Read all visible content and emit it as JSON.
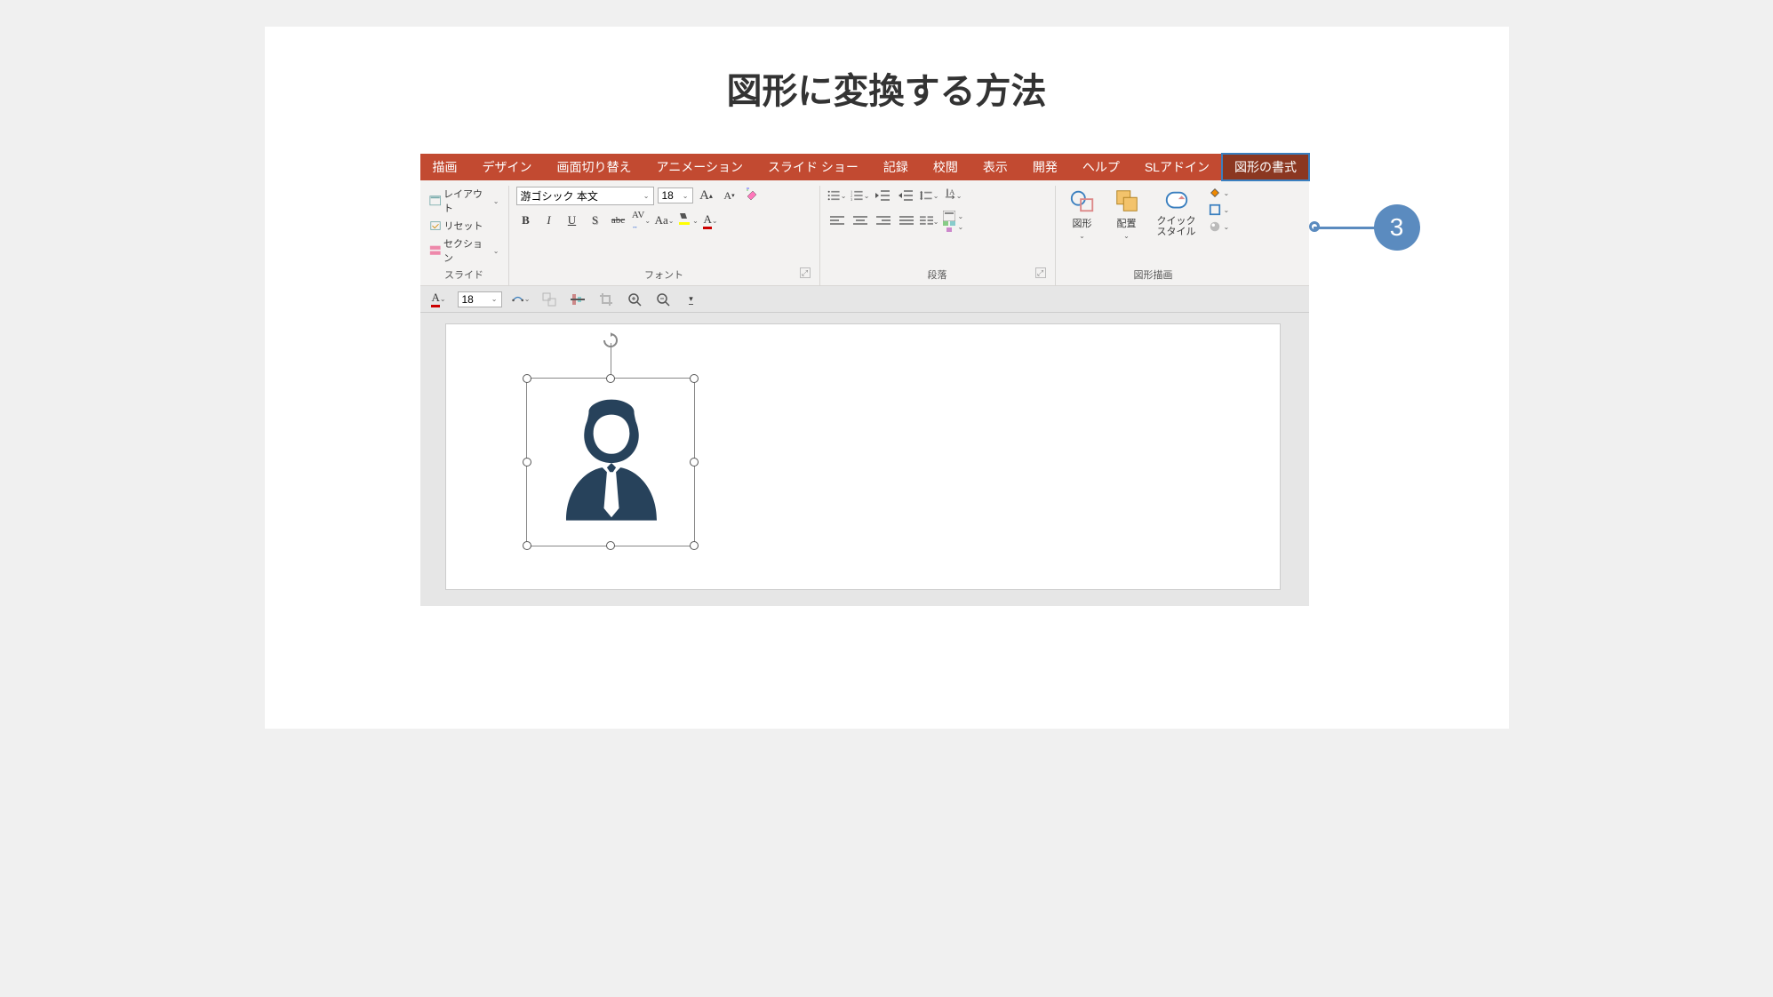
{
  "title": "図形に変換する方法",
  "callout_number": "3",
  "tabs": [
    {
      "label": "描画",
      "active": false
    },
    {
      "label": "デザイン",
      "active": false
    },
    {
      "label": "画面切り替え",
      "active": false
    },
    {
      "label": "アニメーション",
      "active": false
    },
    {
      "label": "スライド ショー",
      "active": false
    },
    {
      "label": "記録",
      "active": false
    },
    {
      "label": "校閲",
      "active": false
    },
    {
      "label": "表示",
      "active": false
    },
    {
      "label": "開発",
      "active": false
    },
    {
      "label": "ヘルプ",
      "active": false
    },
    {
      "label": "SLアドイン",
      "active": false
    },
    {
      "label": "図形の書式",
      "active": true
    }
  ],
  "slide_group": {
    "layout": "レイアウト",
    "reset": "リセット",
    "section": "セクション",
    "label": "スライド"
  },
  "font_group": {
    "font_name": "游ゴシック 本文",
    "font_size": "18",
    "grow": "A",
    "shrink": "A",
    "clear_icon": "clear-format",
    "bold": "B",
    "italic": "I",
    "underline": "U",
    "shadow": "S",
    "strike": "abc",
    "spacing": "AV",
    "case": "Aa",
    "highlight_icon": "highlight",
    "font_color": "A",
    "label": "フォント"
  },
  "paragraph_group": {
    "label": "段落"
  },
  "drawing_group": {
    "shapes": "図形",
    "arrange": "配置",
    "quick_styles": "クイック\nスタイル",
    "label": "図形描画"
  },
  "qat": {
    "font_color": "A",
    "font_size": "18"
  }
}
